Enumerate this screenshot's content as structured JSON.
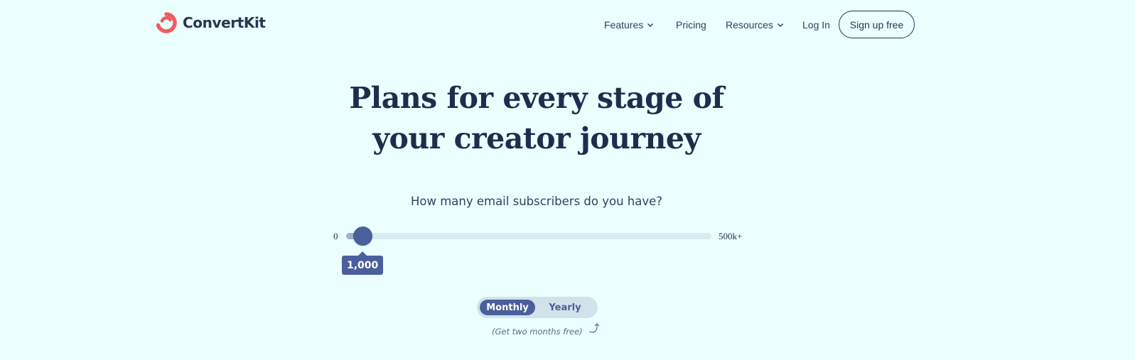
{
  "brand": {
    "name": "ConvertKit",
    "logo_color": "#f05c5c"
  },
  "nav": {
    "features": "Features",
    "pricing": "Pricing",
    "resources": "Resources",
    "login": "Log In",
    "signup": "Sign up free"
  },
  "hero": {
    "title_line1": "Plans for every stage of",
    "title_line2": "your creator journey"
  },
  "subscribers": {
    "question": "How many email subscribers do you have?",
    "min_label": "0",
    "max_label": "500k+",
    "value_label": "1,000",
    "position_fraction": 0.045
  },
  "billing": {
    "monthly": "Monthly",
    "yearly": "Yearly",
    "selected": "Monthly",
    "promo": "(Get two months free)"
  },
  "colors": {
    "background": "#eafffe",
    "primary": "#4a5f9b",
    "text": "#1f2d4d",
    "track": "#d6ecf0"
  }
}
